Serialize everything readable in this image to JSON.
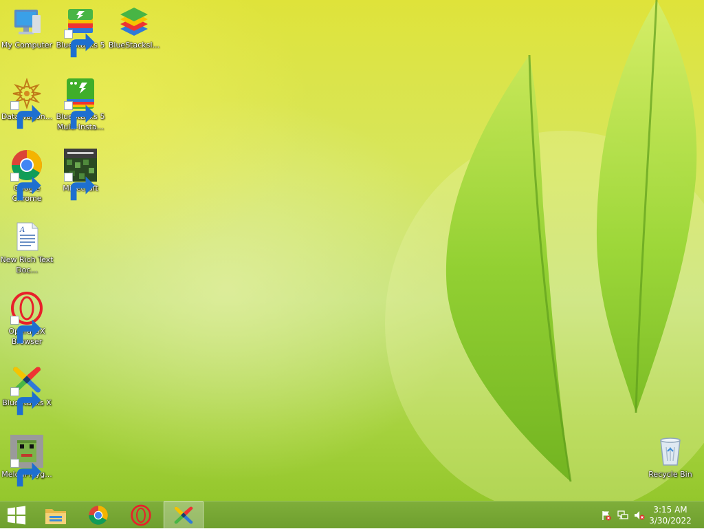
{
  "desktop": {
    "icons": [
      {
        "label": "My Computer"
      },
      {
        "label": "BlueStacks 5"
      },
      {
        "label": "BlueStacksI..."
      },
      {
        "label": "DataWagon..."
      },
      {
        "label": "BlueStacks 5 Multi-Insta..."
      },
      {
        "label": "Google Chrome"
      },
      {
        "label": "Minecraft"
      },
      {
        "label": "New Rich Text Doc..."
      },
      {
        "label": "Opera GX Browser"
      },
      {
        "label": "BlueStacks X"
      },
      {
        "label": "MelonPlayg..."
      },
      {
        "label": "Recycle Bin"
      }
    ]
  },
  "taskbar": {
    "buttons": [
      {
        "name": "start-button",
        "icon": "windows-logo-icon"
      },
      {
        "name": "file-explorer-button",
        "icon": "folder-icon"
      },
      {
        "name": "chrome-button",
        "icon": "chrome-icon"
      },
      {
        "name": "opera-gx-button",
        "icon": "opera-icon"
      },
      {
        "name": "bluestacks-x-button",
        "icon": "bluestacks-x-icon",
        "active": true
      }
    ],
    "tray": {
      "icons": [
        "action-center-flag-icon",
        "network-icon",
        "volume-muted-icon"
      ],
      "time": "3:15 AM",
      "date": "3/30/2022"
    }
  },
  "colors": {
    "taskbar": "#6e9f2e",
    "desktop_top": "#dfe33a",
    "desktop_bottom": "#94c72c"
  }
}
